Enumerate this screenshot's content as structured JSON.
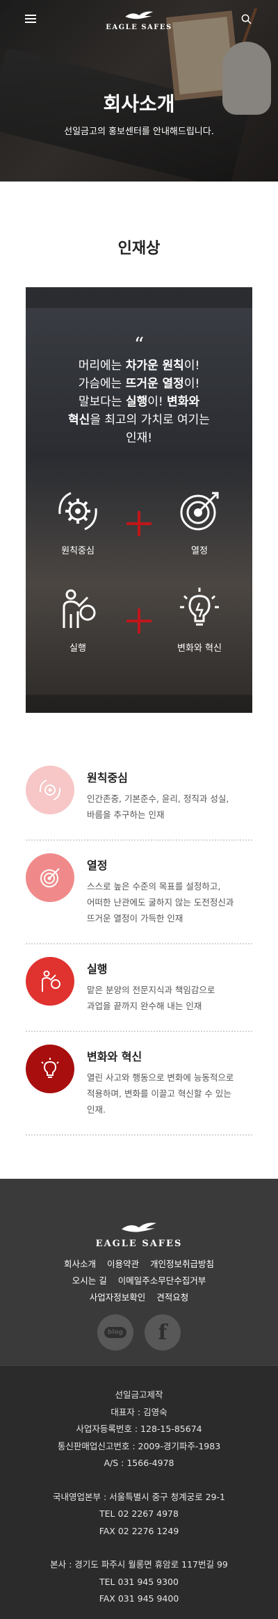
{
  "header": {
    "brand": "EAGLE SAFES",
    "title": "회사소개",
    "subtitle": "선일금고의 홍보센터를 안내해드립니다."
  },
  "section": {
    "title": "인재상"
  },
  "panel": {
    "quote_mark": "“",
    "quote": {
      "l1a": "머리에는 ",
      "l1b": "차가운 원칙",
      "l1c": "이!",
      "l2a": "가슴에는 ",
      "l2b": "뜨거운 열정",
      "l2c": "이!",
      "l3a": "말보다는 ",
      "l3b": "실행",
      "l3c": "이! ",
      "l3d": "변화와",
      "l4a": "혁신",
      "l4b": "을 최고의 가치로 여기는",
      "l5": "인재!"
    },
    "values": [
      "원칙중심",
      "열정",
      "실행",
      "변화와 혁신"
    ]
  },
  "list": [
    {
      "title": "원칙중심",
      "desc1": "인간존중, 기본준수, 윤리, 정직과 성실,",
      "desc2": "바름을 추구하는 인재",
      "desc3": "",
      "color": "#f7c6c6"
    },
    {
      "title": "열정",
      "desc1": "스스로 높은 수준의 목표를 설정하고,",
      "desc2": "어떠한 난관에도 굴하지 않는 도전정신과",
      "desc3": "뜨거운 열정이 가득한 인재",
      "color": "#f08a8a"
    },
    {
      "title": "실행",
      "desc1": "맡은 분양의 전문지식과 책임감으로",
      "desc2": "과업을 끝까지 완수해 내는 인재",
      "desc3": "",
      "color": "#e0322f"
    },
    {
      "title": "변화와 혁신",
      "desc1": "열린 사고와 행동으로 변화에 능동적으로",
      "desc2": "적용하며, 변화를 이끌고 혁신할 수 있는",
      "desc3": "인재.",
      "color": "#a80e0e"
    }
  ],
  "footer": {
    "brand": "EAGLE SAFES",
    "links": [
      "회사소개",
      "이용약관",
      "개인정보취급방침",
      "오시는 길",
      "이메일주소무단수집거부",
      "사업자정보확인",
      "견적요청"
    ],
    "social": {
      "blog": "blog",
      "facebook": "f"
    },
    "company": "선일금고제작",
    "ceo": "대표자 : 김영숙",
    "biz_no": "사업자등록번호 : 128-15-85674",
    "mail_order": "통신판매업신고번호 : 2009-경기파주-1983",
    "as": "A/S : 1566-4978",
    "sales_hq": "국내영업본부 : 서울특별시 중구 청계궁로 29-1",
    "sales_tel": "TEL 02 2267 4978",
    "sales_fax": "FAX 02 2276 1249",
    "hq": "본사 : 경기도 파주시 월롱면 휴암로 117번길 99",
    "hq_tel": "TEL 031 945 9300",
    "hq_fax": "FAX 031 945 9400"
  }
}
